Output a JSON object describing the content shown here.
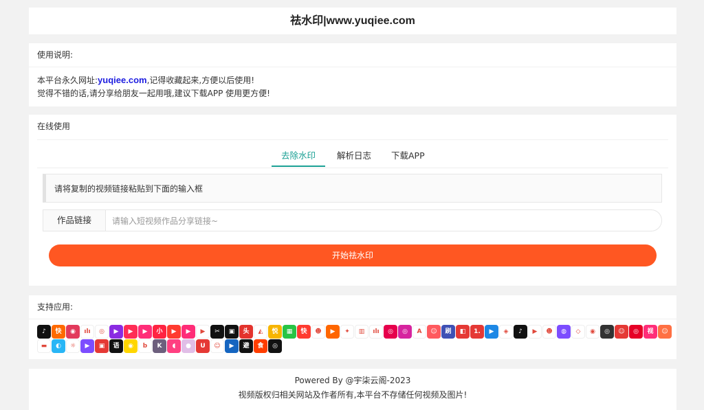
{
  "header": {
    "title": "祛水印|www.yuqiee.com"
  },
  "usage": {
    "title": "使用说明:",
    "line1_prefix": "本平台永久网址:",
    "line1_link": "yuqiee.com",
    "line1_suffix": ",记得收藏起来,方便以后使用!",
    "line2": "觉得不错的话,请分享给朋友一起用哦,建议下载APP 使用更方便!"
  },
  "online": {
    "title": "在线使用",
    "tabs": [
      {
        "label": "去除水印",
        "active": true
      },
      {
        "label": "解析日志",
        "active": false
      },
      {
        "label": "下载APP",
        "active": false
      }
    ],
    "tip": "请将复制的视频链接粘贴到下面的输入框",
    "field_label": "作品链接",
    "input_placeholder": "请输入短视频作品分享链接~",
    "input_value": "",
    "start_button": "开始祛水印"
  },
  "apps": {
    "title": "支持应用:",
    "icons": [
      {
        "name": "douyin-icon",
        "color": "#111111",
        "glyph": "♪"
      },
      {
        "name": "kuaishou-icon",
        "color": "#ff6a00",
        "glyph": "快"
      },
      {
        "name": "app-icon-3",
        "color": "#e23a5c",
        "glyph": "◉"
      },
      {
        "name": "app-icon-4",
        "color": "#ffffff",
        "glyph": "ılı"
      },
      {
        "name": "weibo-icon",
        "color": "#ffffff",
        "glyph": "◎"
      },
      {
        "name": "app-icon-6",
        "color": "#8a2be2",
        "glyph": "▶"
      },
      {
        "name": "app-icon-7",
        "color": "#ff2d55",
        "glyph": "▶"
      },
      {
        "name": "app-icon-8",
        "color": "#ff2d78",
        "glyph": "▶"
      },
      {
        "name": "xiaohongshu-icon",
        "color": "#ff2442",
        "glyph": "小"
      },
      {
        "name": "app-icon-10",
        "color": "#ff3b30",
        "glyph": "▶"
      },
      {
        "name": "app-icon-11",
        "color": "#ff2d78",
        "glyph": "▶"
      },
      {
        "name": "app-icon-12",
        "color": "#ffffff",
        "glyph": "▶"
      },
      {
        "name": "capcut-icon",
        "color": "#111111",
        "glyph": "✂"
      },
      {
        "name": "app-icon-14",
        "color": "#111111",
        "glyph": "▣"
      },
      {
        "name": "toutiao-icon",
        "color": "#e3332d",
        "glyph": "头"
      },
      {
        "name": "app-icon-16",
        "color": "#ffffff",
        "glyph": "◭"
      },
      {
        "name": "app-icon-17",
        "color": "#f7b500",
        "glyph": "悦"
      },
      {
        "name": "app-icon-18",
        "color": "#28c445",
        "glyph": "▦"
      },
      {
        "name": "kuaibao-icon",
        "color": "#ff3b30",
        "glyph": "快"
      },
      {
        "name": "app-icon-20",
        "color": "#ffffff",
        "glyph": "☻"
      },
      {
        "name": "app-icon-21",
        "color": "#ff6600",
        "glyph": "▶"
      },
      {
        "name": "twitter-icon",
        "color": "#ffffff",
        "glyph": "✦"
      },
      {
        "name": "app-icon-23",
        "color": "#ffffff",
        "glyph": "▥"
      },
      {
        "name": "app-icon-24",
        "color": "#ffffff",
        "glyph": "ılı"
      },
      {
        "name": "app-icon-25",
        "color": "#e6004c",
        "glyph": "◎"
      },
      {
        "name": "instagram-icon",
        "color": "#d6249f",
        "glyph": "◎"
      },
      {
        "name": "app-icon-27",
        "color": "#ffffff",
        "glyph": "A"
      },
      {
        "name": "app-icon-28",
        "color": "#ff5a5f",
        "glyph": "☺"
      },
      {
        "name": "app-icon-29",
        "color": "#3f51b5",
        "glyph": "刷"
      },
      {
        "name": "app-icon-30",
        "color": "#e53935",
        "glyph": "◧"
      },
      {
        "name": "app-icon-31",
        "color": "#e53935",
        "glyph": "1."
      },
      {
        "name": "app-icon-32",
        "color": "#1e88e5",
        "glyph": "▶"
      },
      {
        "name": "app-icon-33",
        "color": "#ffffff",
        "glyph": "◈"
      },
      {
        "name": "tiktok-icon",
        "color": "#111111",
        "glyph": "♪"
      },
      {
        "name": "youtube-icon",
        "color": "#ffffff",
        "glyph": "▶"
      },
      {
        "name": "app-icon-36",
        "color": "#ffffff",
        "glyph": "☻"
      },
      {
        "name": "app-icon-37",
        "color": "#7c4dff",
        "glyph": "◍"
      },
      {
        "name": "app-icon-38",
        "color": "#ffffff",
        "glyph": "◇"
      },
      {
        "name": "app-icon-39",
        "color": "#ffffff",
        "glyph": "◉"
      },
      {
        "name": "app-icon-40",
        "color": "#333333",
        "glyph": "◎"
      },
      {
        "name": "app-icon-41",
        "color": "#e53935",
        "glyph": "☺"
      },
      {
        "name": "netease-music-icon",
        "color": "#e60026",
        "glyph": "◎"
      },
      {
        "name": "app-icon-43",
        "color": "#ff2d78",
        "glyph": "视"
      },
      {
        "name": "app-icon-44",
        "color": "#ff7043",
        "glyph": "☺"
      },
      {
        "name": "app-icon-45",
        "color": "#ffffff",
        "glyph": "▬"
      },
      {
        "name": "app-icon-46",
        "color": "#29b6f6",
        "glyph": "◐"
      },
      {
        "name": "app-icon-47",
        "color": "#ffffff",
        "glyph": "☼"
      },
      {
        "name": "app-icon-48",
        "color": "#7c4dff",
        "glyph": "▶"
      },
      {
        "name": "app-icon-49",
        "color": "#e53935",
        "glyph": "▣"
      },
      {
        "name": "app-icon-50",
        "color": "#111111",
        "glyph": "语"
      },
      {
        "name": "app-icon-51",
        "color": "#ffd600",
        "glyph": "◉"
      },
      {
        "name": "app-icon-52",
        "color": "#ffffff",
        "glyph": "b"
      },
      {
        "name": "app-icon-53",
        "color": "#6d5f7d",
        "glyph": "K"
      },
      {
        "name": "app-icon-54",
        "color": "#ff4081",
        "glyph": "◖"
      },
      {
        "name": "app-icon-55",
        "color": "#e1bee7",
        "glyph": "●"
      },
      {
        "name": "app-icon-56",
        "color": "#e53935",
        "glyph": "U"
      },
      {
        "name": "app-icon-57",
        "color": "#ffffff",
        "glyph": "☺"
      },
      {
        "name": "app-icon-58",
        "color": "#1565c0",
        "glyph": "▶"
      },
      {
        "name": "app-icon-59",
        "color": "#111111",
        "glyph": "避"
      },
      {
        "name": "app-icon-60",
        "color": "#ff3d00",
        "glyph": "食"
      },
      {
        "name": "app-icon-61",
        "color": "#111111",
        "glyph": "◎"
      }
    ]
  },
  "footer": {
    "line1": "Powered By @宇柒云阁-2023",
    "line2": "视频版权归相关网站及作者所有,本平台不存储任何视频及图片!"
  }
}
